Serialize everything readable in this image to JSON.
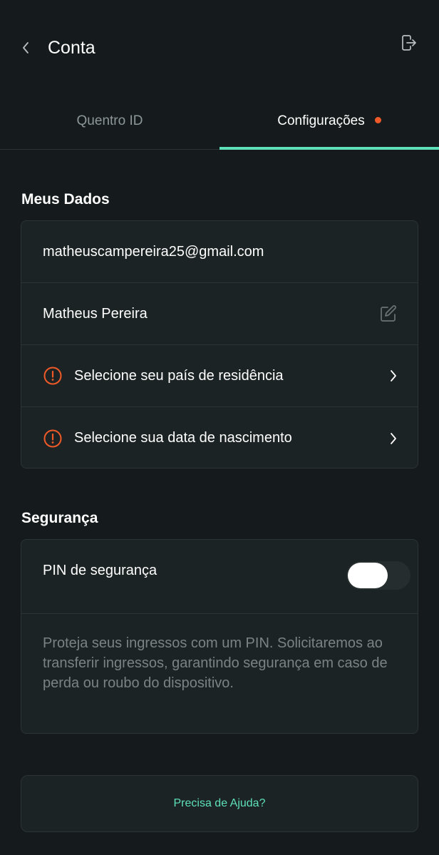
{
  "header": {
    "title": "Conta",
    "back_icon": "chevron-left-icon",
    "logout_icon": "logout-icon"
  },
  "tabs": [
    {
      "label": "Quentro ID",
      "active": false
    },
    {
      "label": "Configurações",
      "active": true,
      "has_notification": true
    }
  ],
  "meus_dados": {
    "title": "Meus Dados",
    "email": "matheuscampereira25@gmail.com",
    "name": "Matheus Pereira",
    "country_prompt": "Selecione seu país de residência",
    "birthdate_prompt": "Selecione sua data de nascimento"
  },
  "seguranca": {
    "title": "Segurança",
    "pin_label": "PIN de segurança",
    "pin_enabled": false,
    "pin_description": "Proteja seus ingressos com um PIN. Solicitaremos ao transferir ingressos, garantindo segurança em caso de perda ou roubo do dispositivo."
  },
  "help": {
    "label": "Precisa de Ajuda?"
  },
  "colors": {
    "background": "#151b1c",
    "card": "#1c2324",
    "border": "#2c3435",
    "accent": "#5de0b8",
    "alert": "#ef5a28",
    "muted_text": "#7a8384"
  }
}
